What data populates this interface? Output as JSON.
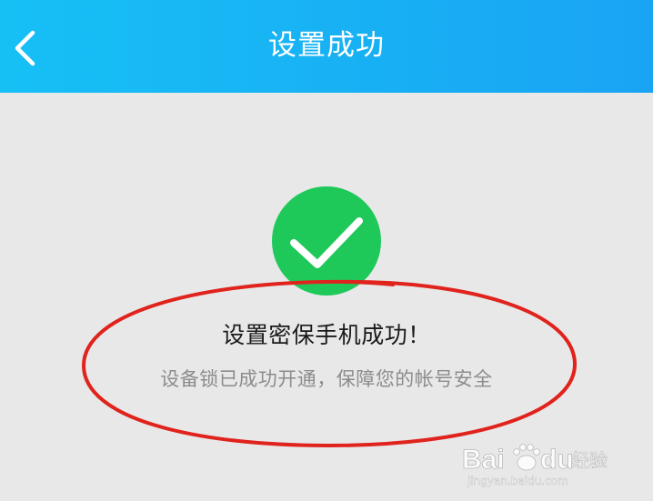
{
  "header": {
    "title": "设置成功",
    "back_icon": "chevron-left-icon",
    "background_colors": [
      "#16c0f5",
      "#1aa4f4"
    ]
  },
  "result": {
    "icon": "checkmark-circle-icon",
    "icon_color": "#1ec95a",
    "title": "设置密保手机成功！",
    "subtitle": "设备锁已成功开通，保障您的帐号安全"
  },
  "annotation": {
    "shape": "ellipse",
    "color": "#e0231c"
  },
  "watermark": {
    "brand_left": "Bai",
    "brand_right": "du",
    "suffix": "经验",
    "url": "jingyan.baidu.com"
  }
}
